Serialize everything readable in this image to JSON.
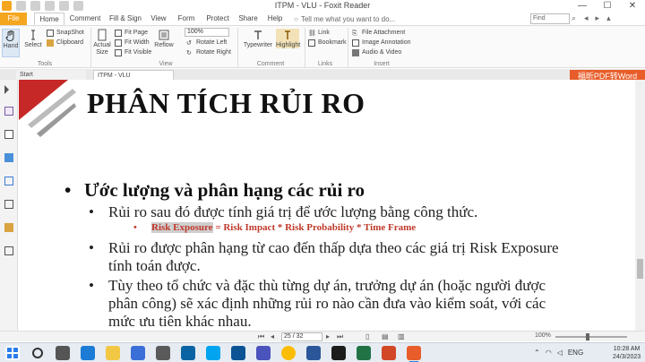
{
  "window": {
    "title": "ITPM - VLU - Foxit Reader",
    "controls": [
      "—",
      "☐",
      "✕"
    ]
  },
  "ribbon_tabs": [
    "File",
    "Home",
    "Comment",
    "Fill & Sign",
    "View",
    "Form",
    "Protect",
    "Share",
    "Help"
  ],
  "tell_me_placeholder": "Tell me what you want to do...",
  "find_placeholder": "Find",
  "ribbon": {
    "hand": "Hand",
    "select": "Select",
    "snapshot": "SnapShot",
    "clipboard": "Clipboard",
    "actual_size": "Actual Size",
    "fit_page": "Fit Page",
    "fit_width": "Fit Width",
    "fit_visible": "Fit Visible",
    "reflow": "Reflow",
    "zoom_value": "100%",
    "zoom_in": "",
    "rotate_left": "Rotate Left",
    "rotate_right": "Rotate Right",
    "typewriter": "Typewriter",
    "highlight": "Highlight",
    "link": "Link",
    "bookmark": "Bookmark",
    "file_attachment": "File Attachment",
    "image_annotation": "Image Annotation",
    "audio_video": "Audio & Video",
    "groups": {
      "tools": "Tools",
      "view": "View",
      "comment": "Comment",
      "links": "Links",
      "insert": "Insert"
    }
  },
  "doc_tabs": [
    "Start",
    "ITPM - VLU"
  ],
  "watermark_text": "福昕PDF转Word",
  "slide": {
    "title": "PHÂN TÍCH RỦI RO",
    "bullet1": "Ước lượng và phân hạng các rủi ro",
    "sub1": "Rủi ro sau đó được tính giá trị để ước lượng bằng công thức.",
    "formula_highlight": "Risk Exposure",
    "formula_rest": " = Risk Impact * Risk Probability * Time Frame",
    "sub2_line1": "Rủi ro được phân hạng từ cao đến thấp dựa theo các giá trị Risk Exposure",
    "sub2_line2": "tính toán được.",
    "sub3_line1": "Tùy theo tổ chức và đặc thù từng dự án, trưởng dự án (hoặc người được",
    "sub3_line2": "phân công) sẽ xác định những rủi ro nào cần đưa vào kiểm soát, với các",
    "sub3_line3": "mức ưu tiên khác nhau."
  },
  "status": {
    "page_box": "25 / 32",
    "zoom_percent": "100%"
  },
  "taskbar": {
    "time": "10:28 AM",
    "date": "24/3/2023",
    "lang": "ENG"
  }
}
